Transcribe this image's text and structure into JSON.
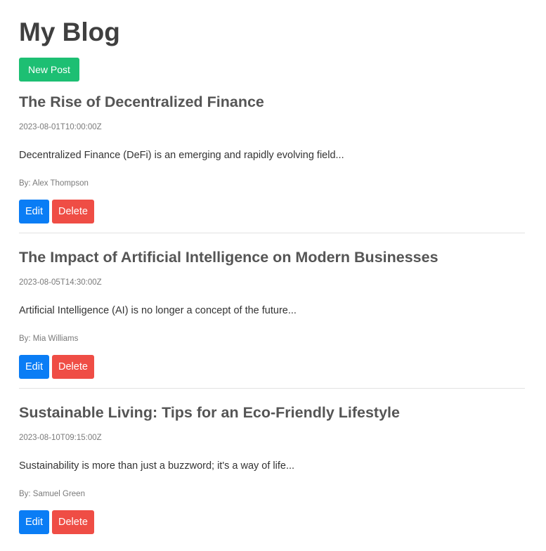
{
  "page": {
    "title": "My Blog",
    "new_post_label": "New Post"
  },
  "posts": [
    {
      "title": "The Rise of Decentralized Finance",
      "date": "2023-08-01T10:00:00Z",
      "excerpt": "Decentralized Finance (DeFi) is an emerging and rapidly evolving field...",
      "author": "By: Alex Thompson",
      "edit_label": "Edit",
      "delete_label": "Delete"
    },
    {
      "title": "The Impact of Artificial Intelligence on Modern Businesses",
      "date": "2023-08-05T14:30:00Z",
      "excerpt": "Artificial Intelligence (AI) is no longer a concept of the future...",
      "author": "By: Mia Williams",
      "edit_label": "Edit",
      "delete_label": "Delete"
    },
    {
      "title": "Sustainable Living: Tips for an Eco-Friendly Lifestyle",
      "date": "2023-08-10T09:15:00Z",
      "excerpt": "Sustainability is more than just a buzzword; it's a way of life...",
      "author": "By: Samuel Green",
      "edit_label": "Edit",
      "delete_label": "Delete"
    }
  ],
  "colors": {
    "new_post": "#1dbf73",
    "edit": "#0a7df5",
    "delete": "#ef4d45"
  }
}
